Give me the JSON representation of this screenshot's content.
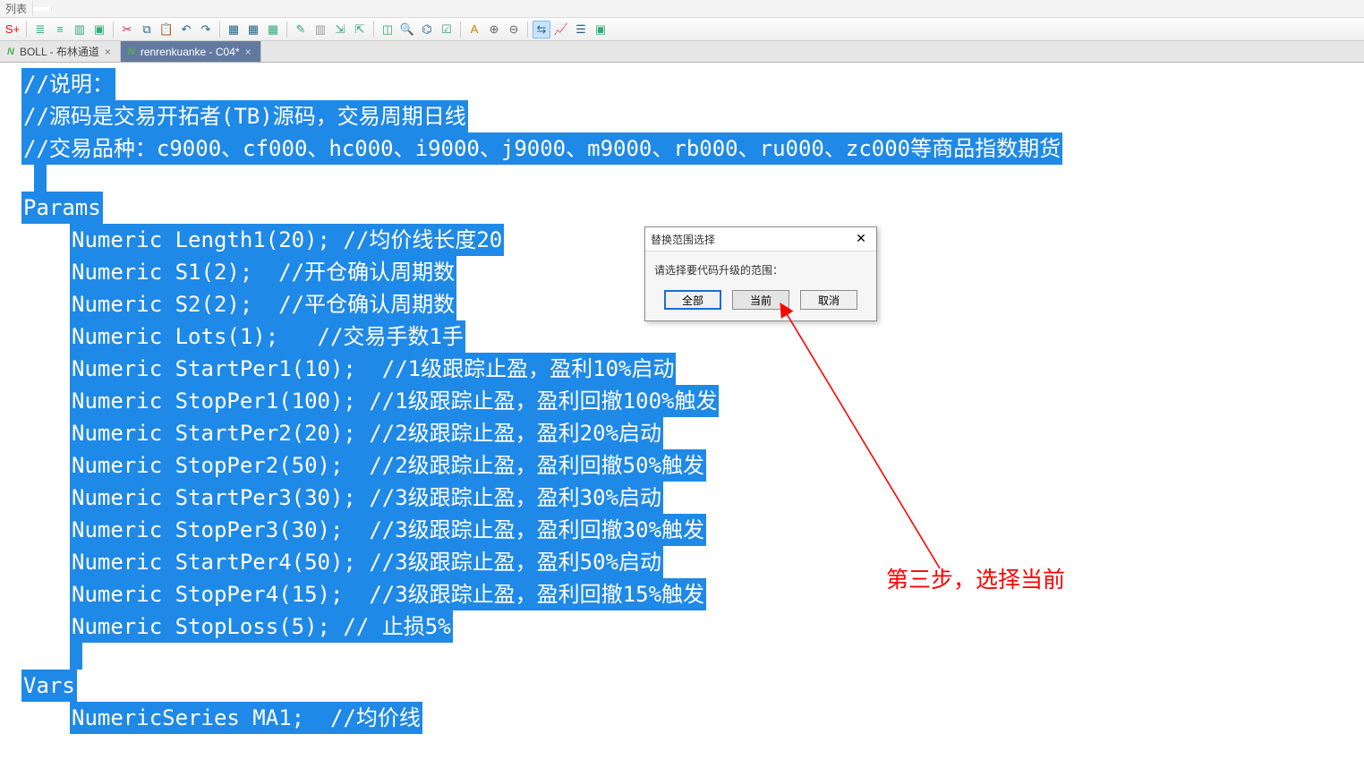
{
  "top_tabs": {
    "partial_left": "列表",
    "active": ""
  },
  "toolbar_icons": [
    {
      "name": "s-plus-icon",
      "glyph": "S+",
      "color": "#d11"
    },
    {
      "name": "list-1-icon",
      "glyph": "≣",
      "color": "#3a7"
    },
    {
      "name": "list-2-icon",
      "glyph": "≡",
      "color": "#3a7"
    },
    {
      "name": "list-select-icon",
      "glyph": "▥",
      "color": "#3a7"
    },
    {
      "name": "select-rect-icon",
      "glyph": "▣",
      "color": "#3a7"
    },
    {
      "name": "cut-icon",
      "glyph": "✂",
      "color": "#d24"
    },
    {
      "name": "copy-icon",
      "glyph": "⧉",
      "color": "#268"
    },
    {
      "name": "paste-icon",
      "glyph": "📋",
      "color": "#268"
    },
    {
      "name": "undo-icon",
      "glyph": "↶",
      "color": "#268"
    },
    {
      "name": "redo-icon",
      "glyph": "↷",
      "color": "#268"
    },
    {
      "name": "grid-1-icon",
      "glyph": "▦",
      "color": "#268"
    },
    {
      "name": "grid-2-icon",
      "glyph": "▦",
      "color": "#268"
    },
    {
      "name": "blocks-icon",
      "glyph": "▦",
      "color": "#3a7"
    },
    {
      "name": "edit-green-icon",
      "glyph": "✎",
      "color": "#3a7"
    },
    {
      "name": "doc-icon",
      "glyph": "▥",
      "color": "#999"
    },
    {
      "name": "import-icon",
      "glyph": "⇲",
      "color": "#3a7"
    },
    {
      "name": "export-icon",
      "glyph": "⇱",
      "color": "#3a7"
    },
    {
      "name": "chart-icon",
      "glyph": "◫",
      "color": "#3a7"
    },
    {
      "name": "zoom-icon",
      "glyph": "🔍",
      "color": "#268"
    },
    {
      "name": "tree-icon",
      "glyph": "⌬",
      "color": "#268"
    },
    {
      "name": "check-doc-icon",
      "glyph": "☑",
      "color": "#3a7"
    },
    {
      "name": "text-a-icon",
      "glyph": "A",
      "color": "#c80"
    },
    {
      "name": "mag-plus-icon",
      "glyph": "⊕",
      "color": "#666"
    },
    {
      "name": "mag-minus-icon",
      "glyph": "⊖",
      "color": "#666"
    },
    {
      "name": "sync-icon",
      "glyph": "⇆",
      "color": "#268",
      "active": true
    },
    {
      "name": "line-chart-icon",
      "glyph": "📈",
      "color": "#268"
    },
    {
      "name": "rules-icon",
      "glyph": "☰",
      "color": "#268"
    },
    {
      "name": "target-icon",
      "glyph": "▣",
      "color": "#3a7"
    }
  ],
  "doc_tabs": [
    {
      "label": "BOLL - 布林通道",
      "active": false
    },
    {
      "label": "renrenkuanke - C04*",
      "active": true
    }
  ],
  "code_lines": [
    {
      "indent": 0,
      "text": "//说明："
    },
    {
      "indent": 0,
      "text": "//源码是交易开拓者(TB)源码，交易周期日线"
    },
    {
      "indent": 0,
      "text": "//交易品种：c9000、cf000、hc000、i9000、j9000、m9000、rb000、ru000、zc000等商品指数期货"
    },
    {
      "indent": 0,
      "text": "",
      "blank": true,
      "lead": true
    },
    {
      "indent": 0,
      "text": "Params"
    },
    {
      "indent": 1,
      "text": "Numeric Length1(20); //均价线长度20"
    },
    {
      "indent": 1,
      "text": "Numeric S1(2);  //开仓确认周期数"
    },
    {
      "indent": 1,
      "text": "Numeric S2(2);  //平仓确认周期数"
    },
    {
      "indent": 1,
      "text": "Numeric Lots(1);   //交易手数1手"
    },
    {
      "indent": 1,
      "text": "Numeric StartPer1(10);  //1级跟踪止盈，盈利10%启动"
    },
    {
      "indent": 1,
      "text": "Numeric StopPer1(100); //1级跟踪止盈，盈利回撤100%触发"
    },
    {
      "indent": 1,
      "text": "Numeric StartPer2(20); //2级跟踪止盈，盈利20%启动"
    },
    {
      "indent": 1,
      "text": "Numeric StopPer2(50);  //2级跟踪止盈，盈利回撤50%触发"
    },
    {
      "indent": 1,
      "text": "Numeric StartPer3(30); //3级跟踪止盈，盈利30%启动"
    },
    {
      "indent": 1,
      "text": "Numeric StopPer3(30);  //3级跟踪止盈，盈利回撤30%触发"
    },
    {
      "indent": 1,
      "text": "Numeric StartPer4(50); //3级跟踪止盈，盈利50%启动"
    },
    {
      "indent": 1,
      "text": "Numeric StopPer4(15);  //3级跟踪止盈，盈利回撤15%触发"
    },
    {
      "indent": 1,
      "text": "Numeric StopLoss(5); // 止损5%"
    },
    {
      "indent": 1,
      "text": "",
      "blank": true
    },
    {
      "indent": 0,
      "text": "Vars"
    },
    {
      "indent": 1,
      "text": "NumericSeries MA1;  //均价线"
    }
  ],
  "dialog": {
    "title": "替换范围选择",
    "message": "请选择要代码升级的范围：",
    "btn_all": "全部",
    "btn_current": "当前",
    "btn_cancel": "取消"
  },
  "annotation": "第三步，选择当前"
}
